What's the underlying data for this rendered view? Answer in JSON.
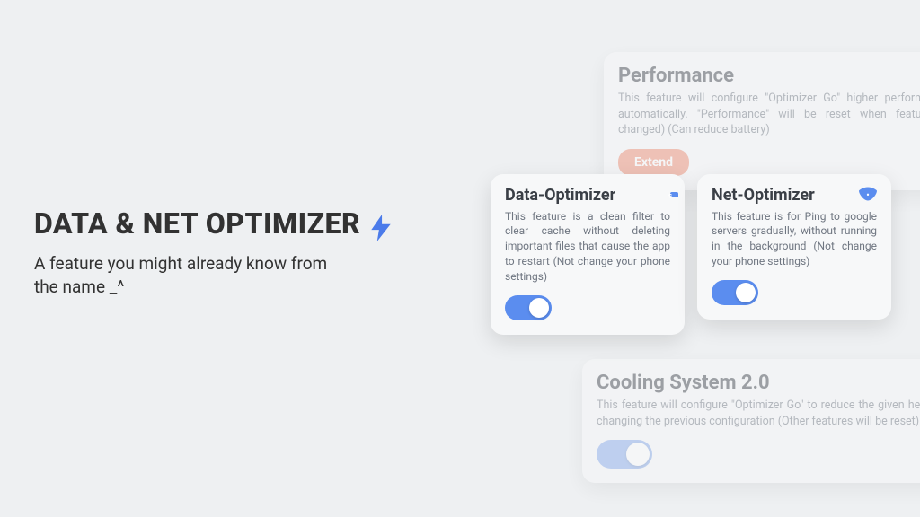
{
  "hero": {
    "title": "DATA & NET OPTIMIZER",
    "subtitle": "A feature you might already know from the name _^"
  },
  "cards": {
    "performance": {
      "title": "Performance",
      "desc": "This feature will configure \"Optimizer Go\" higher performance automatically. \"Performance\" will be reset when feature is changed) (Can reduce battery)",
      "button": "Extend"
    },
    "data": {
      "title": "Data-Optimizer",
      "desc": "This feature is a clean filter to clear cache without deleting important files that cause the app to restart (Not change your phone settings)"
    },
    "net": {
      "title": "Net-Optimizer",
      "desc": "This feature is for Ping to google servers gradually, without running in the background (Not change your phone settings)"
    },
    "cooling": {
      "title": "Cooling System 2.0",
      "desc": "This feature will configure \"Optimizer Go\" to reduce the given heat by changing the previous configuration (Other features will be reset)"
    }
  }
}
